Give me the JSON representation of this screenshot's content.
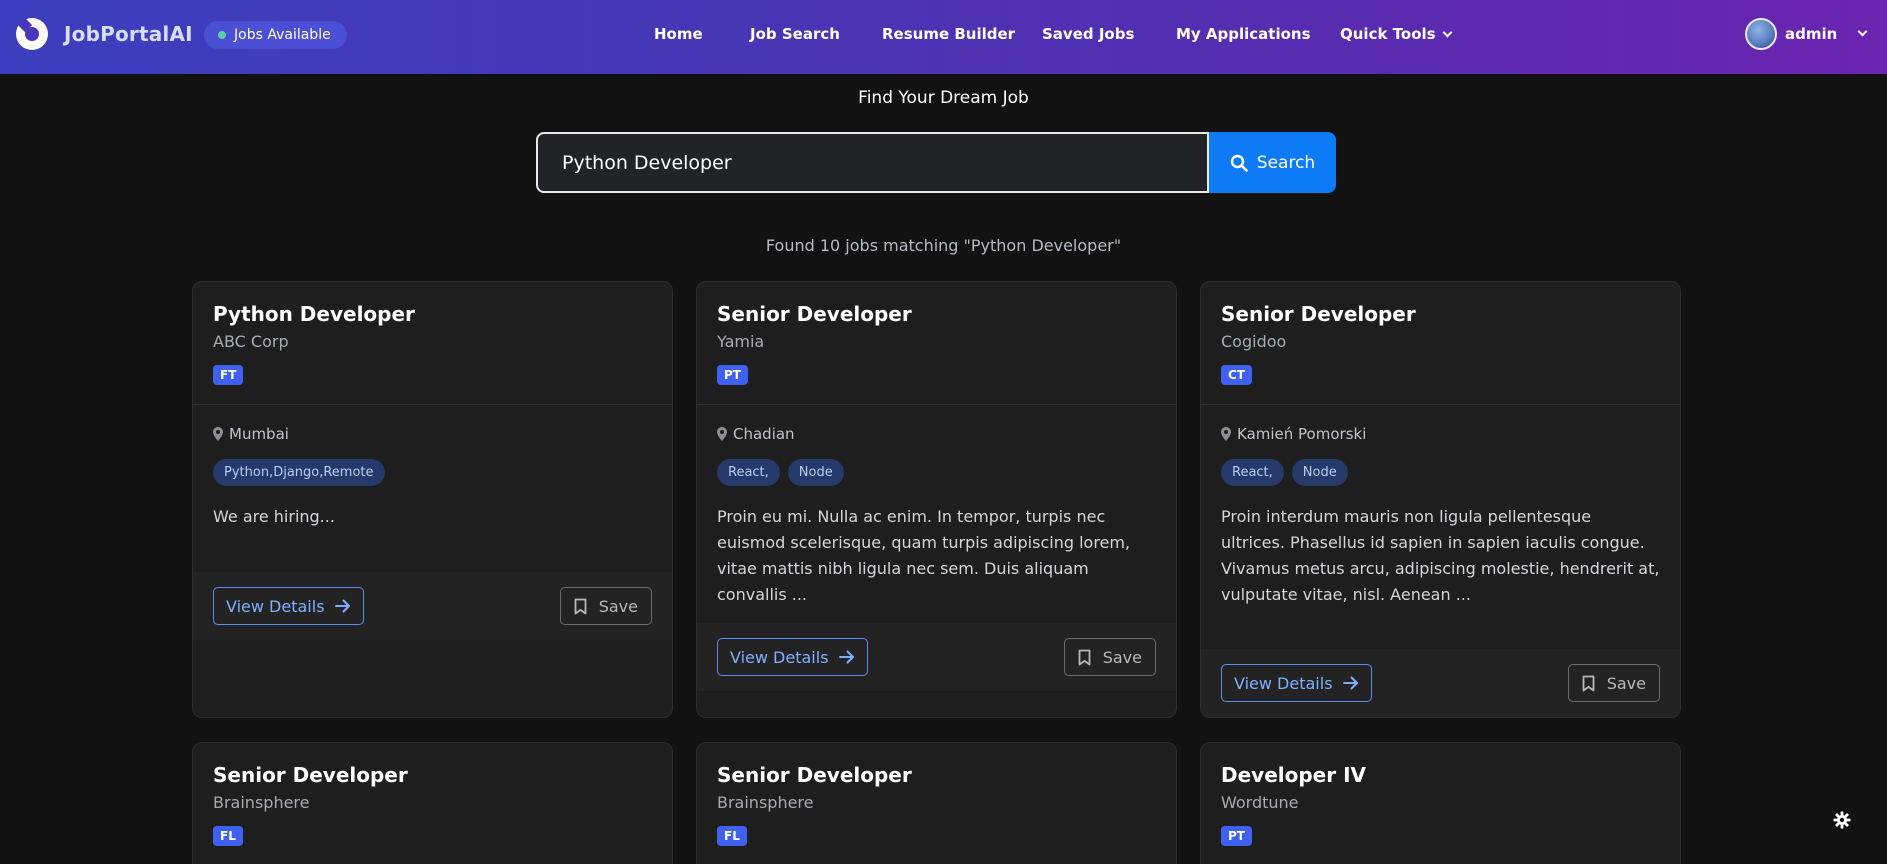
{
  "navbar": {
    "brand": "JobPortalAI",
    "jobs_pill": "Jobs Available",
    "links": [
      "Home",
      "Job Search",
      "Resume Builder",
      "Saved Jobs",
      "My Applications",
      "Quick Tools"
    ],
    "user": "admin"
  },
  "hero": {
    "title": "Find Your Dream Job",
    "search_value": "Python Developer",
    "search_button": "Search"
  },
  "results": {
    "count_text": "Found 10 jobs matching \"Python Developer\""
  },
  "jobs": [
    {
      "title": "Python Developer",
      "company": "ABC Corp",
      "type": "FT",
      "location": "Mumbai",
      "skills": [
        "Python,Django,Remote"
      ],
      "description": "We are hiring...",
      "view_label": "View Details",
      "save_label": "Save"
    },
    {
      "title": "Senior Developer",
      "company": "Yamia",
      "type": "PT",
      "location": "Chadian",
      "skills": [
        "React,",
        "Node"
      ],
      "description": "Proin eu mi. Nulla ac enim. In tempor, turpis nec euismod scelerisque, quam turpis adipiscing lorem, vitae mattis nibh ligula nec sem. Duis aliquam convallis ...",
      "view_label": "View Details",
      "save_label": "Save"
    },
    {
      "title": "Senior Developer",
      "company": "Cogidoo",
      "type": "CT",
      "location": "Kamień Pomorski",
      "skills": [
        "React,",
        "Node"
      ],
      "description": "Proin interdum mauris non ligula pellentesque ultrices. Phasellus id sapien in sapien iaculis congue. Vivamus metus arcu, adipiscing molestie, hendrerit at, vulputate vitae, nisl. Aenean ...",
      "view_label": "View Details",
      "save_label": "Save"
    },
    {
      "title": "Senior Developer",
      "company": "Brainsphere",
      "type": "FL"
    },
    {
      "title": "Senior Developer",
      "company": "Brainsphere",
      "type": "FL"
    },
    {
      "title": "Developer IV",
      "company": "Wordtune",
      "type": "PT"
    }
  ],
  "icons": {
    "search": "search-icon",
    "location": "map-marker-icon",
    "arrow": "arrow-right-icon",
    "bookmark": "bookmark-icon",
    "theme": "gear-icon"
  },
  "colors": {
    "accent": "#0d7bf5",
    "badge": "#4060f0",
    "navbar_start": "#3b3fbf",
    "navbar_end": "#6a24b0",
    "background": "#121212"
  }
}
